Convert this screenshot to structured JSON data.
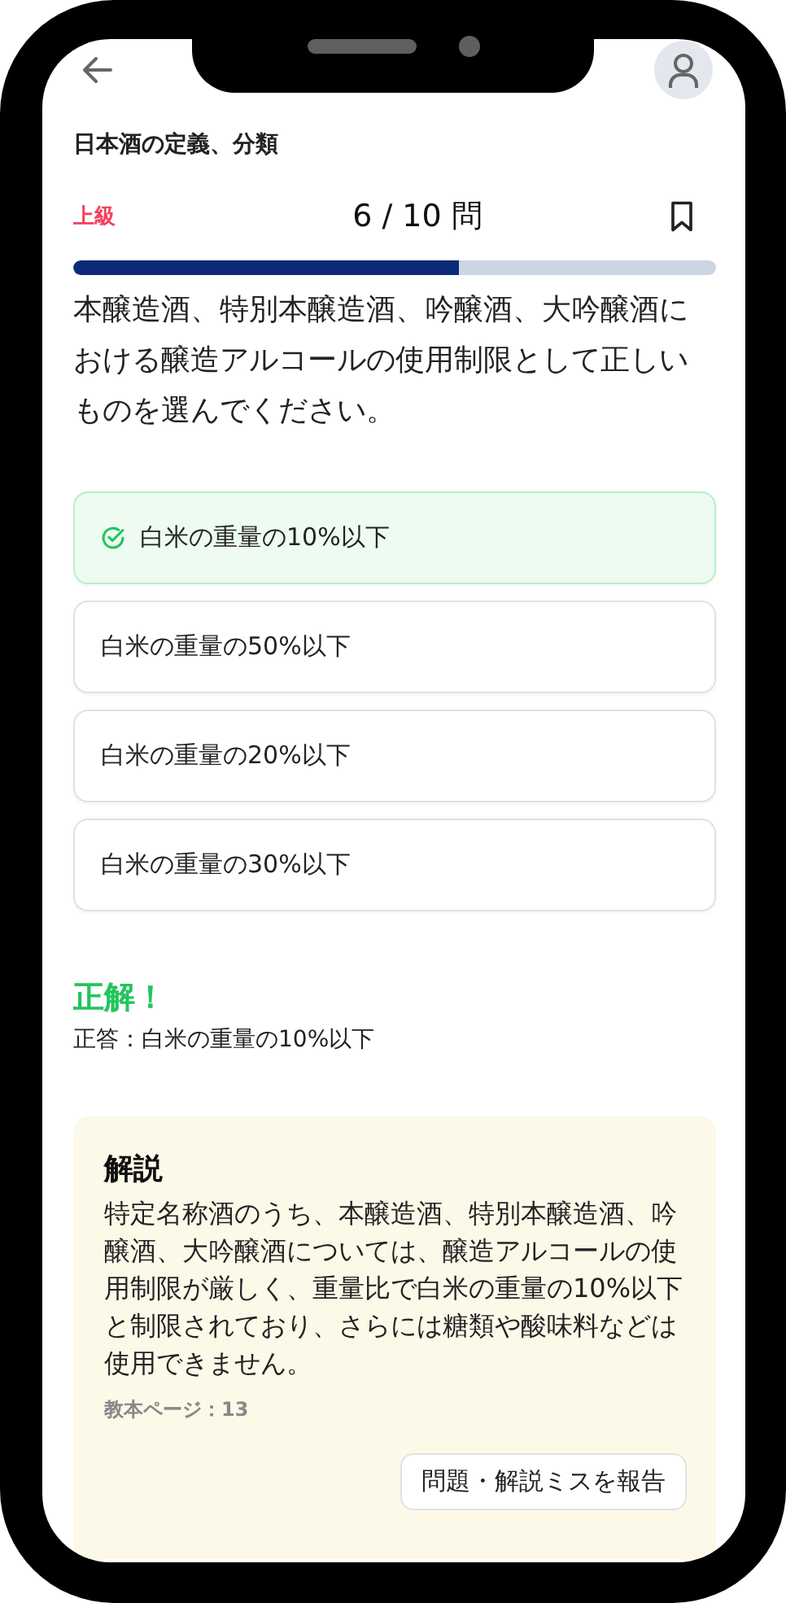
{
  "header": {
    "title": "日本酒の定義、分類"
  },
  "quiz": {
    "level_label": "上級",
    "counter": "6 / 10 問",
    "progress": {
      "level": 0.6
    },
    "bookmarked": false
  },
  "question": "本醸造酒、特別本醸造酒、吟醸酒、大吟醸酒における醸造アルコールの使用制限として正しいものを選んでください。",
  "options": [
    {
      "text": "白米の重量の10%以下",
      "selected": true
    },
    {
      "text": "白米の重量の50%以下",
      "selected": false
    },
    {
      "text": "白米の重量の20%以下",
      "selected": false
    },
    {
      "text": "白米の重量の30%以下",
      "selected": false
    }
  ],
  "result": {
    "heading": "正解！",
    "answer": "正答：白米の重量の10%以下"
  },
  "explanation": {
    "title": "解説",
    "body": "特定名称酒のうち、本醸造酒、特別本醸造酒、吟醸酒、大吟醸酒については、醸造アルコールの使用制限が厳しく、重量比で白米の重量の10%以下と制限されており、さらには糖類や酸味料などは使用できません。",
    "page_ref": "教本ページ：13",
    "report_button": "問題・解説ミスを報告"
  }
}
